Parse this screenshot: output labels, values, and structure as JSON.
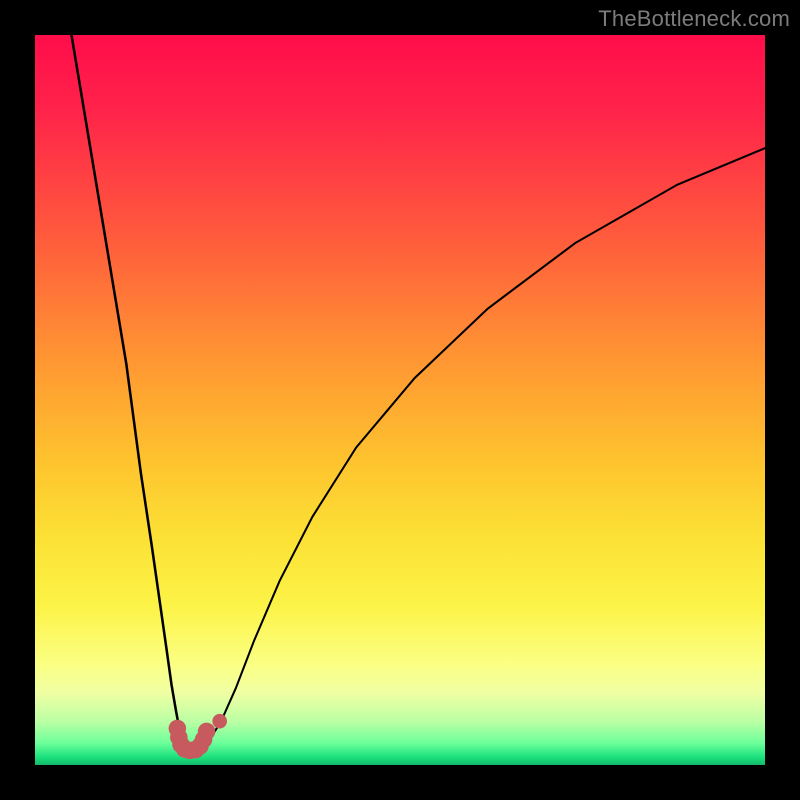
{
  "watermark": "TheBottleneck.com",
  "colors": {
    "background_frame": "#000000",
    "gradient_top": "#ff0d4a",
    "gradient_mid_upper": "#ff9832",
    "gradient_mid": "#fcdf34",
    "gradient_lower": "#fbff81",
    "gradient_bottom": "#14b869",
    "curve_stroke": "#000000",
    "marker_fill": "#c65a5e"
  },
  "chart_data": {
    "type": "line",
    "title": "",
    "xlabel": "",
    "ylabel": "",
    "x_range": [
      0,
      100
    ],
    "y_range": [
      0,
      100
    ],
    "note": "Axes are implicit (no tick labels shown). Curve values estimated from pixel positions; y=100 at top, y=0 at bottom, x=0 left, x=100 right.",
    "series": [
      {
        "name": "left-branch",
        "x": [
          5.0,
          7.5,
          10.0,
          12.5,
          14.5,
          16.0,
          17.0,
          18.0,
          18.7,
          19.3,
          19.8,
          20.3
        ],
        "y": [
          100.0,
          85.0,
          70.0,
          55.0,
          40.0,
          30.0,
          23.0,
          16.0,
          11.0,
          7.5,
          4.8,
          3.0
        ]
      },
      {
        "name": "valley-and-right-branch",
        "x": [
          20.3,
          21.0,
          22.0,
          23.0,
          24.0,
          25.5,
          27.5,
          30.0,
          33.5,
          38.0,
          44.0,
          52.0,
          62.0,
          74.0,
          88.0,
          100.0
        ],
        "y": [
          3.0,
          2.2,
          2.0,
          2.4,
          3.6,
          6.0,
          10.5,
          17.0,
          25.2,
          34.0,
          43.5,
          53.0,
          62.5,
          71.5,
          79.5,
          84.5
        ]
      }
    ],
    "markers": [
      {
        "name": "u-marker-left-top",
        "x": 19.5,
        "y": 5.0,
        "r": 1.2
      },
      {
        "name": "u-marker-left-mid",
        "x": 19.7,
        "y": 3.8,
        "r": 1.2
      },
      {
        "name": "u-marker-left-bot",
        "x": 20.0,
        "y": 2.8,
        "r": 1.2
      },
      {
        "name": "u-marker-bottom-1",
        "x": 20.5,
        "y": 2.2,
        "r": 1.2
      },
      {
        "name": "u-marker-bottom-2",
        "x": 21.2,
        "y": 2.0,
        "r": 1.2
      },
      {
        "name": "u-marker-bottom-3",
        "x": 22.0,
        "y": 2.1,
        "r": 1.2
      },
      {
        "name": "u-marker-right-bot",
        "x": 22.6,
        "y": 2.6,
        "r": 1.2
      },
      {
        "name": "u-marker-right-mid",
        "x": 23.1,
        "y": 3.5,
        "r": 1.2
      },
      {
        "name": "u-marker-right-top",
        "x": 23.5,
        "y": 4.6,
        "r": 1.2
      },
      {
        "name": "detached-dot",
        "x": 25.3,
        "y": 6.0,
        "r": 1.0
      }
    ]
  }
}
